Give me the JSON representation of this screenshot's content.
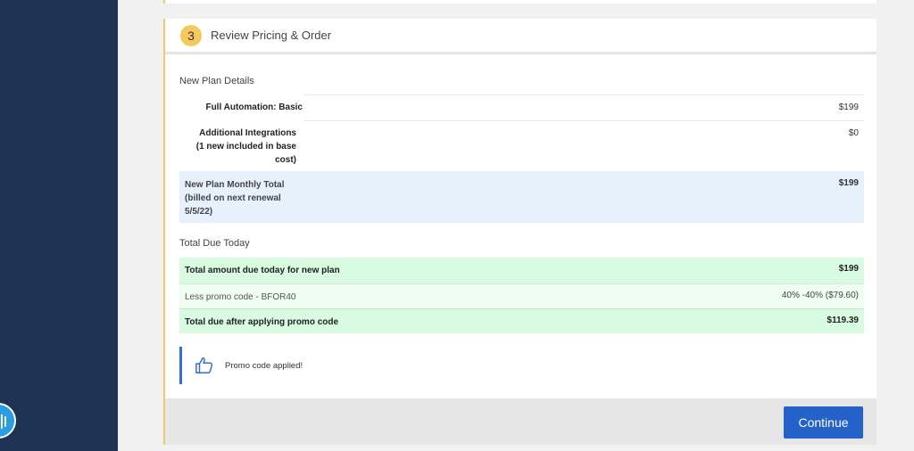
{
  "colors": {
    "sidebar": "#1e3353",
    "accent_yellow": "#f6c95e",
    "brand_blue": "#2461c9",
    "highlight_blue": "#e6f1fc",
    "highlight_green": "#d9fbe2",
    "light_green": "#f0fdf3"
  },
  "step": {
    "number": "3",
    "title": "Review Pricing & Order"
  },
  "plan_details": {
    "label": "New Plan Details",
    "items": [
      {
        "name": "Full Automation: Basic",
        "price": "$199"
      },
      {
        "name": "Additional Integrations (1 new included in base cost)",
        "price": "$0"
      }
    ],
    "monthly_total": {
      "label": "New Plan Monthly Total (billed on next renewal 5/5/22)",
      "value": "$199"
    }
  },
  "total_due": {
    "label": "Total Due Today",
    "rows": [
      {
        "label": "Total amount due today for new plan",
        "value": "$199"
      },
      {
        "label": "Less promo code - BFOR40",
        "value": "40% -40% ($79.60)"
      },
      {
        "label": "Total due after applying promo code",
        "value": "$119.39"
      }
    ]
  },
  "promo": {
    "icon": "thumbs-up-icon",
    "message": "Promo code applied!"
  },
  "footer": {
    "continue_label": "Continue"
  }
}
